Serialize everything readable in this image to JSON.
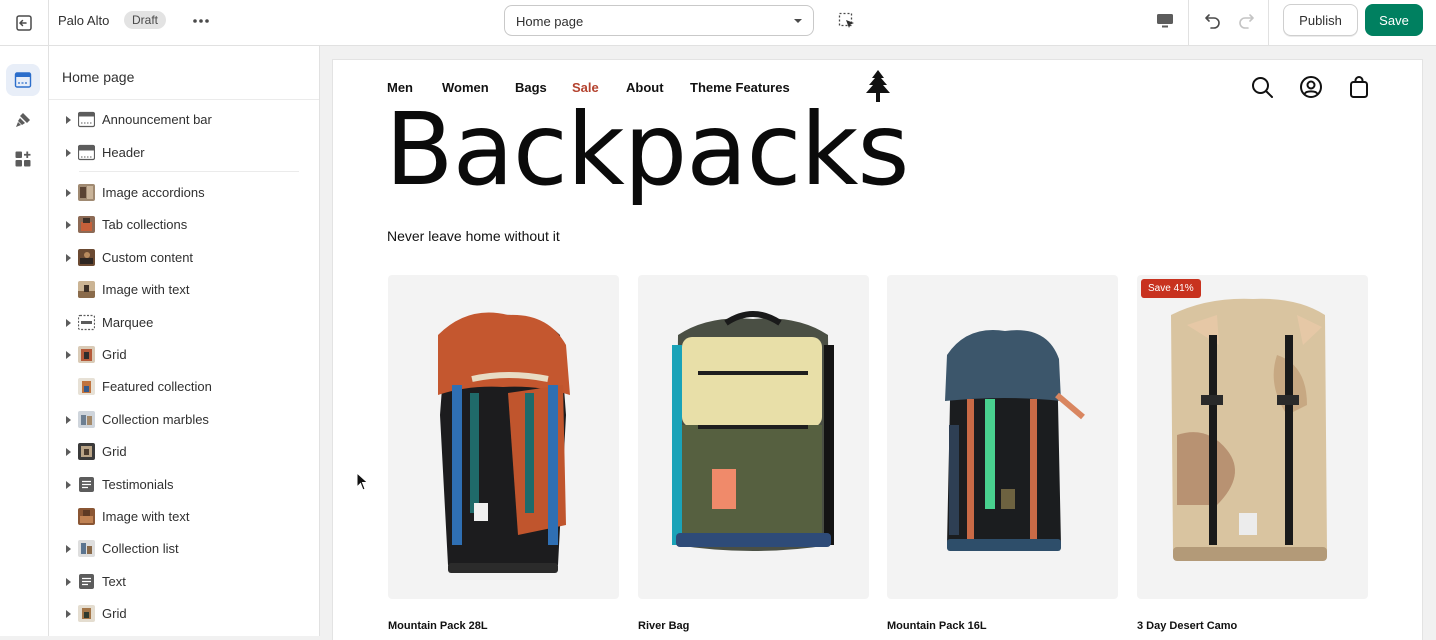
{
  "topbar": {
    "theme_name": "Palo Alto",
    "status_badge": "Draft",
    "page_select": "Home page",
    "publish_label": "Publish",
    "save_label": "Save"
  },
  "sidebar": {
    "title": "Home page",
    "items": [
      {
        "label": "Announcement bar",
        "expandable": true,
        "icon": "section-bar-icon"
      },
      {
        "label": "Header",
        "expandable": true,
        "icon": "section-header-icon"
      },
      {
        "label": "Image accordions",
        "expandable": true,
        "icon": "image-thumbnail-icon"
      },
      {
        "label": "Tab collections",
        "expandable": true,
        "icon": "image-thumbnail-icon"
      },
      {
        "label": "Custom content",
        "expandable": true,
        "icon": "image-thumbnail-icon"
      },
      {
        "label": "Image with text",
        "expandable": false,
        "icon": "image-thumbnail-icon"
      },
      {
        "label": "Marquee",
        "expandable": true,
        "icon": "marquee-icon"
      },
      {
        "label": "Grid",
        "expandable": true,
        "icon": "image-thumbnail-icon"
      },
      {
        "label": "Featured collection",
        "expandable": false,
        "icon": "image-thumbnail-icon"
      },
      {
        "label": "Collection marbles",
        "expandable": true,
        "icon": "image-thumbnail-icon"
      },
      {
        "label": "Grid",
        "expandable": true,
        "icon": "image-thumbnail-icon"
      },
      {
        "label": "Testimonials",
        "expandable": true,
        "icon": "text-section-icon"
      },
      {
        "label": "Image with text",
        "expandable": false,
        "icon": "image-thumbnail-icon"
      },
      {
        "label": "Collection list",
        "expandable": true,
        "icon": "image-thumbnail-icon"
      },
      {
        "label": "Text",
        "expandable": true,
        "icon": "text-section-icon"
      },
      {
        "label": "Grid",
        "expandable": true,
        "icon": "image-thumbnail-icon"
      }
    ]
  },
  "preview": {
    "nav": [
      "Men",
      "Women",
      "Bags",
      "Sale",
      "About",
      "Theme Features"
    ],
    "title": "Backpacks",
    "subtitle": "Never leave home without it",
    "products": [
      {
        "name": "Mountain Pack 28L",
        "badge": ""
      },
      {
        "name": "River Bag",
        "badge": ""
      },
      {
        "name": "Mountain Pack 16L",
        "badge": ""
      },
      {
        "name": "3 Day Desert Camo",
        "badge": "Save 41%"
      }
    ]
  },
  "colors": {
    "accent_green": "#008060",
    "sale_red": "#b4432f",
    "badge_red": "#c8321f"
  }
}
